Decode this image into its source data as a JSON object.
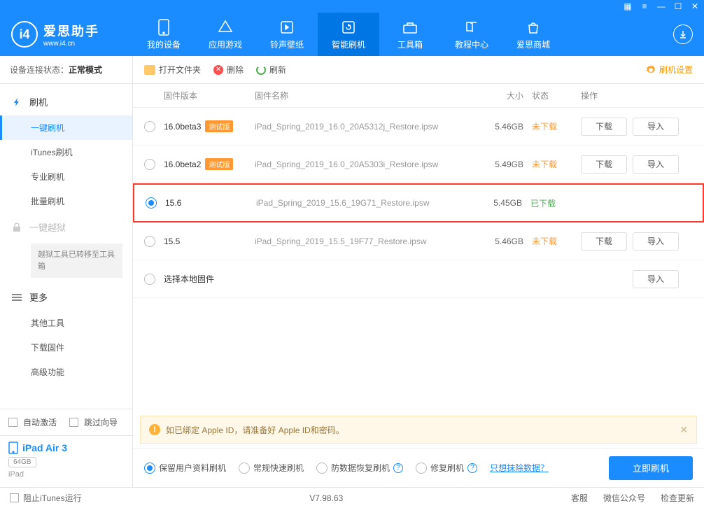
{
  "app": {
    "name": "爱思助手",
    "domain": "www.i4.cn"
  },
  "nav": {
    "items": [
      {
        "label": "我的设备"
      },
      {
        "label": "应用游戏"
      },
      {
        "label": "铃声壁纸"
      },
      {
        "label": "智能刷机"
      },
      {
        "label": "工具箱"
      },
      {
        "label": "教程中心"
      },
      {
        "label": "爱思商城"
      }
    ],
    "active_index": 3
  },
  "status": {
    "label": "设备连接状态：",
    "value": "正常模式"
  },
  "sidebar": {
    "flash_root": "刷机",
    "items": [
      "一键刷机",
      "iTunes刷机",
      "专业刷机",
      "批量刷机"
    ],
    "jailbreak": "一键越狱",
    "jailbreak_note": "越狱工具已转移至工具箱",
    "more_root": "更多",
    "more_items": [
      "其他工具",
      "下载固件",
      "高级功能"
    ],
    "auto_activate": "自动激活",
    "skip_guide": "跳过向导",
    "device": {
      "name": "iPad Air 3",
      "capacity": "64GB",
      "type": "iPad"
    }
  },
  "toolbar": {
    "open": "打开文件夹",
    "del": "删除",
    "refresh": "刷新",
    "settings": "刷机设置"
  },
  "columns": {
    "version": "固件版本",
    "name": "固件名称",
    "size": "大小",
    "status": "状态",
    "ops": "操作"
  },
  "rows": [
    {
      "version": "16.0beta3",
      "beta": true,
      "name": "iPad_Spring_2019_16.0_20A5312j_Restore.ipsw",
      "size": "5.46GB",
      "status": "未下载",
      "downloaded": false,
      "selected": false
    },
    {
      "version": "16.0beta2",
      "beta": true,
      "name": "iPad_Spring_2019_16.0_20A5303i_Restore.ipsw",
      "size": "5.49GB",
      "status": "未下载",
      "downloaded": false,
      "selected": false
    },
    {
      "version": "15.6",
      "beta": false,
      "name": "iPad_Spring_2019_15.6_19G71_Restore.ipsw",
      "size": "5.45GB",
      "status": "已下载",
      "downloaded": true,
      "selected": true,
      "highlight": true
    },
    {
      "version": "15.5",
      "beta": false,
      "name": "iPad_Spring_2019_15.5_19F77_Restore.ipsw",
      "size": "5.46GB",
      "status": "未下载",
      "downloaded": false,
      "selected": false
    }
  ],
  "local_row": "选择本地固件",
  "btns": {
    "download": "下载",
    "import": "导入"
  },
  "beta_tag": "测试版",
  "notice": "如已绑定 Apple ID，请准备好 Apple ID和密码。",
  "action": {
    "options": [
      "保留用户资料刷机",
      "常规快速刷机",
      "防数据恢复刷机",
      "修复刷机"
    ],
    "selected_index": 0,
    "erase_link": "只想抹除数据？",
    "flash": "立即刷机"
  },
  "footer": {
    "block_itunes": "阻止iTunes运行",
    "version": "V7.98.63",
    "links": [
      "客服",
      "微信公众号",
      "检查更新"
    ]
  }
}
